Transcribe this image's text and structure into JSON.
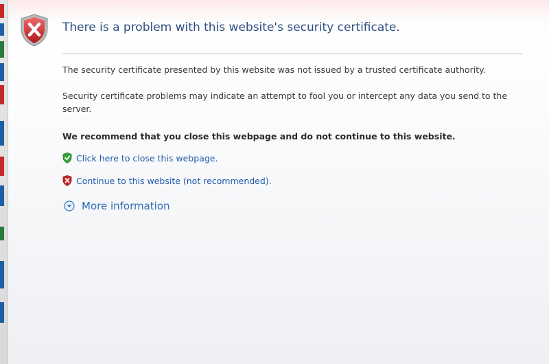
{
  "header": {
    "title": "There is a problem with this website's security certificate."
  },
  "body": {
    "paragraph1": "The security certificate presented by this website was not issued by a trusted certificate authority.",
    "paragraph2": "Security certificate problems may indicate an attempt to fool you or intercept any data you send to the server.",
    "recommendation": "We recommend that you close this webpage and do not continue to this website."
  },
  "actions": {
    "close": {
      "label": "Click here to close this webpage.",
      "icon": "green-shield-check-icon"
    },
    "continue": {
      "label": "Continue to this website (not recommended).",
      "icon": "red-shield-x-icon"
    }
  },
  "more_info": {
    "label": "More information",
    "icon": "expand-down-icon"
  },
  "colors": {
    "title": "#2c4f83",
    "link": "#1f5aa8",
    "danger": "#c62828",
    "safe": "#3aa537"
  }
}
